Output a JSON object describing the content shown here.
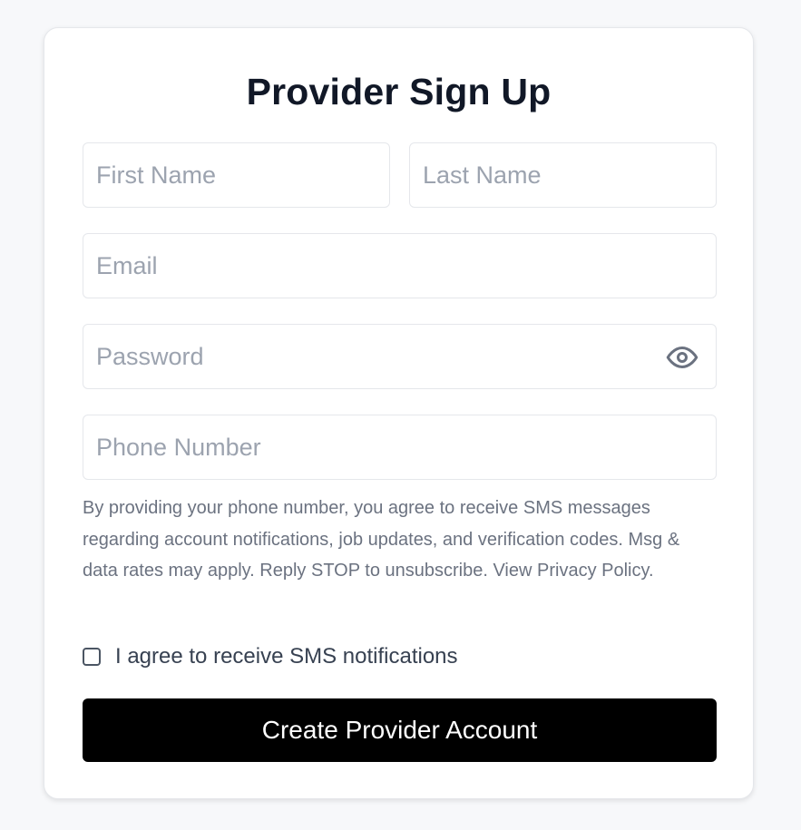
{
  "form": {
    "title": "Provider Sign Up",
    "first_name": {
      "placeholder": "First Name",
      "value": ""
    },
    "last_name": {
      "placeholder": "Last Name",
      "value": ""
    },
    "email": {
      "placeholder": "Email",
      "value": ""
    },
    "password": {
      "placeholder": "Password",
      "value": "",
      "toggle_icon": "eye-icon"
    },
    "phone": {
      "placeholder": "Phone Number",
      "value": ""
    },
    "sms_disclaimer": "By providing your phone number, you agree to receive SMS messages regarding account notifications, job updates, and verification codes. Msg & data rates may apply. Reply STOP to unsubscribe. View Privacy Policy.",
    "sms_consent": {
      "label": "I agree to receive SMS notifications",
      "checked": false
    },
    "submit_label": "Create Provider Account"
  },
  "colors": {
    "page_background": "#f7f8fa",
    "card_background": "#ffffff",
    "title_text": "#111827",
    "placeholder_text": "#9ca3af",
    "body_text": "#6b7280",
    "button_background": "#000000",
    "button_text": "#ffffff"
  }
}
